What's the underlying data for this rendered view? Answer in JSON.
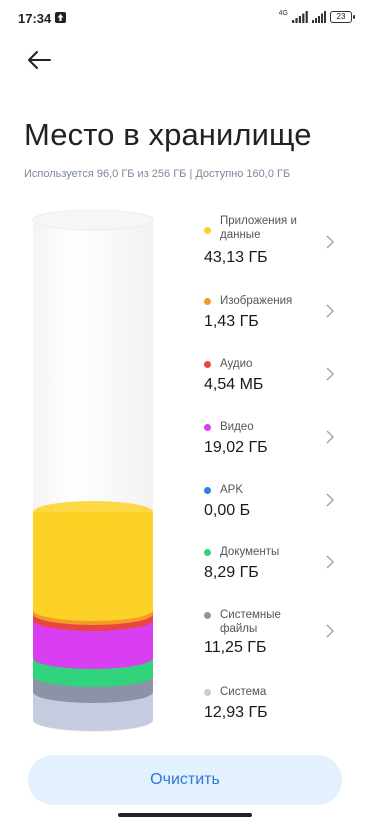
{
  "status_bar": {
    "time": "17:34",
    "network": "4G",
    "battery": "23"
  },
  "header": {
    "title": "Место в хранилище"
  },
  "usage": {
    "summary": "Используется 96,0 ГБ из 256 ГБ | Доступно 160,0 ГБ",
    "used_gb": 96.0,
    "total_gb": 256,
    "available_gb": 160.0
  },
  "categories": [
    {
      "label": "Приложения и данные",
      "size": "43,13 ГБ",
      "color": "#fdd226"
    },
    {
      "label": "Изображения",
      "size": "1,43 ГБ",
      "color": "#f59a2a"
    },
    {
      "label": "Аудио",
      "size": "4,54 МБ",
      "color": "#e8463f"
    },
    {
      "label": "Видео",
      "size": "19,02 ГБ",
      "color": "#d93ef2"
    },
    {
      "label": "APK",
      "size": "0,00 Б",
      "color": "#2e7fe0"
    },
    {
      "label": "Документы",
      "size": "8,29 ГБ",
      "color": "#2fd47d"
    },
    {
      "label": "Системные файлы",
      "size": "11,25 ГБ",
      "color": "#8d93a7"
    },
    {
      "label": "Система",
      "size": "12,93 ГБ",
      "color": "#c6ccdf"
    }
  ],
  "actions": {
    "clear_label": "Очистить"
  }
}
